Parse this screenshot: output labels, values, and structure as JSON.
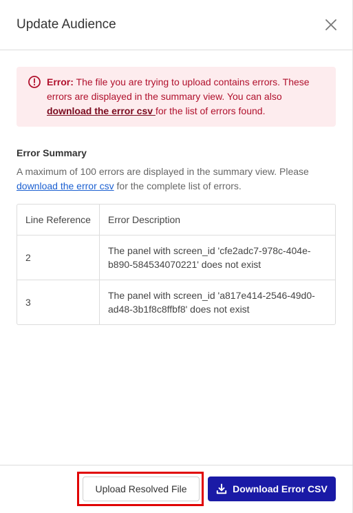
{
  "modal": {
    "title": "Update Audience"
  },
  "alert": {
    "label": "Error:",
    "message": " The file you are trying to upload contains errors. These errors are displayed in the summary view. You can also ",
    "link": "download the error csv ",
    "suffix": "for the list of errors found."
  },
  "summary": {
    "title": "Error Summary",
    "text": "A maximum of 100 errors are displayed in the summary view. Please ",
    "link": "download the error csv",
    "suffix": " for the complete list of errors."
  },
  "table": {
    "headers": [
      "Line Reference",
      "Error Description"
    ],
    "rows": [
      {
        "line": "2",
        "description": "The panel with screen_id 'cfe2adc7-978c-404e-b890-584534070221' does not exist"
      },
      {
        "line": "3",
        "description": "The panel with screen_id 'a817e414-2546-49d0-ad48-3b1f8c8ffbf8' does not exist"
      }
    ]
  },
  "footer": {
    "upload_label": "Upload Resolved File",
    "download_label": "Download Error CSV"
  },
  "icons": {
    "close": "close-icon",
    "alert": "error-circle-icon",
    "download": "download-icon"
  },
  "colors": {
    "error_bg": "#fdecee",
    "error_text": "#b0102c",
    "primary": "#1a1aa6",
    "highlight": "#e00000"
  }
}
